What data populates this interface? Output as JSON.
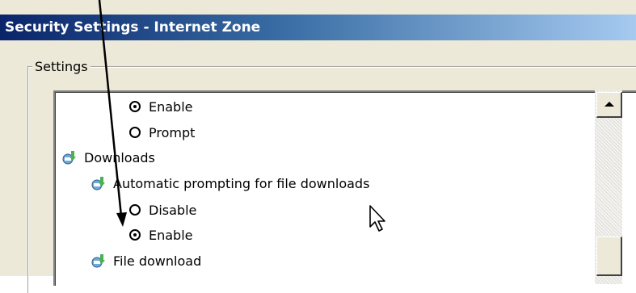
{
  "window": {
    "title": "Security Settings - Internet Zone"
  },
  "settings_group": {
    "label": "Settings"
  },
  "tree": {
    "enable_top": "Enable",
    "prompt": "Prompt",
    "downloads": "Downloads",
    "auto_prompting": "Automatic prompting for file downloads",
    "disable": "Disable",
    "enable_selected": "Enable",
    "file_download": "File download"
  },
  "radio_states": {
    "enable_top": "checked",
    "prompt": "unchecked",
    "disable": "unchecked",
    "enable_selected": "checked"
  },
  "icons": {
    "node_icon": "settings-download-icon",
    "cursor": "mouse-pointer-icon",
    "arrow": "annotation-arrow-icon"
  },
  "colors": {
    "title_start": "#0a246a",
    "title_end": "#a6caf0",
    "dialog_bg": "#ece9d8"
  }
}
